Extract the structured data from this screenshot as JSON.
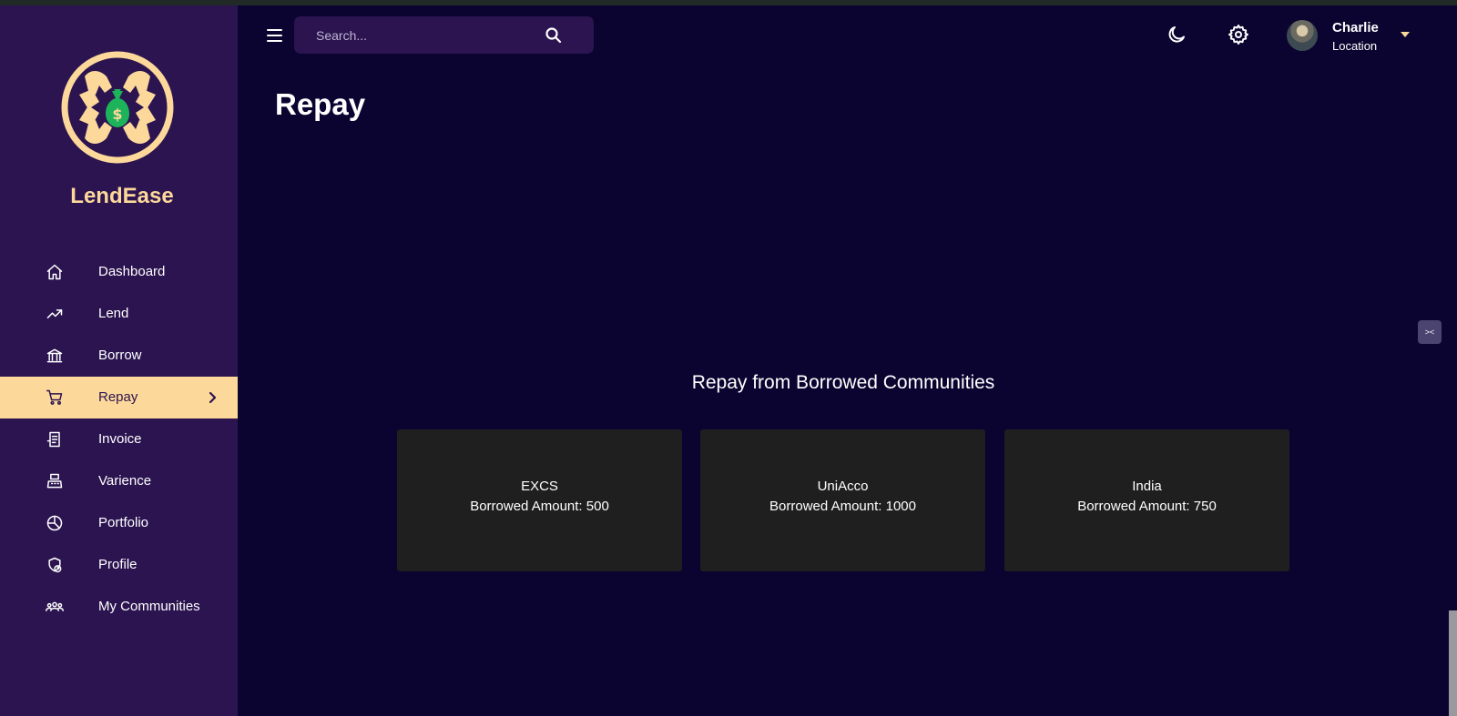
{
  "brand": {
    "name": "LendEase",
    "logo_colors": {
      "ring": "#fcd89a",
      "bag": "#1db35a"
    }
  },
  "sidebar": {
    "items": [
      {
        "label": "Dashboard",
        "icon": "home-icon",
        "active": false
      },
      {
        "label": "Lend",
        "icon": "trending-up-icon",
        "active": false
      },
      {
        "label": "Borrow",
        "icon": "bank-icon",
        "active": false
      },
      {
        "label": "Repay",
        "icon": "cart-icon",
        "active": true
      },
      {
        "label": "Invoice",
        "icon": "receipt-icon",
        "active": false
      },
      {
        "label": "Varience",
        "icon": "register-icon",
        "active": false
      },
      {
        "label": "Portfolio",
        "icon": "pie-chart-icon",
        "active": false
      },
      {
        "label": "Profile",
        "icon": "shield-clock-icon",
        "active": false
      },
      {
        "label": "My Communities",
        "icon": "group-icon",
        "active": false
      }
    ]
  },
  "topbar": {
    "search_placeholder": "Search...",
    "user": {
      "name": "Charlie",
      "location": "Location"
    }
  },
  "page": {
    "title": "Repay",
    "section_title": "Repay from Borrowed Communities",
    "communities": [
      {
        "name": "EXCS",
        "amount_text": "Borrowed Amount: 500"
      },
      {
        "name": "UniAcco",
        "amount_text": "Borrowed Amount: 1000"
      },
      {
        "name": "India",
        "amount_text": "Borrowed Amount: 750"
      }
    ]
  },
  "colors": {
    "background": "#0b0430",
    "sidebar": "#2b1450",
    "accent": "#fcd89a",
    "card": "#1f1f1f"
  }
}
